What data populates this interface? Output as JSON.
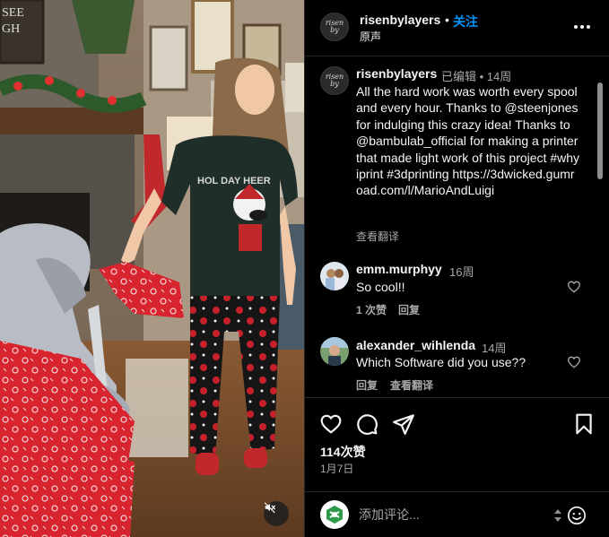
{
  "post": {
    "username": "risenbylayers",
    "dot": "•",
    "follow_label": "关注",
    "audio_label": "原声",
    "avatar_logo_line1": "risen",
    "avatar_logo_line2": "by"
  },
  "caption": {
    "username": "risenbylayers",
    "meta": "已编辑 • 14周",
    "text": "All the hard work was worth every spool and every hour. Thanks to @steenjones for indulging this crazy idea! Thanks to @bambulab_official for making a printer that made light work of this project #whyiprint #3dprinting https://3dwicked.gumroad.com/l/MarioAndLuigi",
    "translate_label": "查看翻译"
  },
  "comments": [
    {
      "username": "emm.murphyy",
      "time": "16周",
      "text": "So cool!!",
      "likes_label": "1 次赞",
      "reply_label": "回复"
    },
    {
      "username": "alexander_wihlenda",
      "time": "14周",
      "text": "Which Software did you use??",
      "reply_label": "回复",
      "translate_label": "查看翻译"
    }
  ],
  "stats": {
    "likes": "114次赞",
    "date": "1月7日"
  },
  "composer": {
    "placeholder": "添加评论..."
  },
  "icons": {
    "like": "heart-icon",
    "comment": "comment-bubble-icon",
    "share": "paper-plane-icon",
    "save": "bookmark-icon",
    "more": "more-dots-icon",
    "mute": "speaker-muted-icon",
    "emoji": "smiley-icon"
  },
  "colors": {
    "follow_blue": "#0095f6",
    "background": "#000000",
    "secondary_text": "#a8a8a8"
  }
}
